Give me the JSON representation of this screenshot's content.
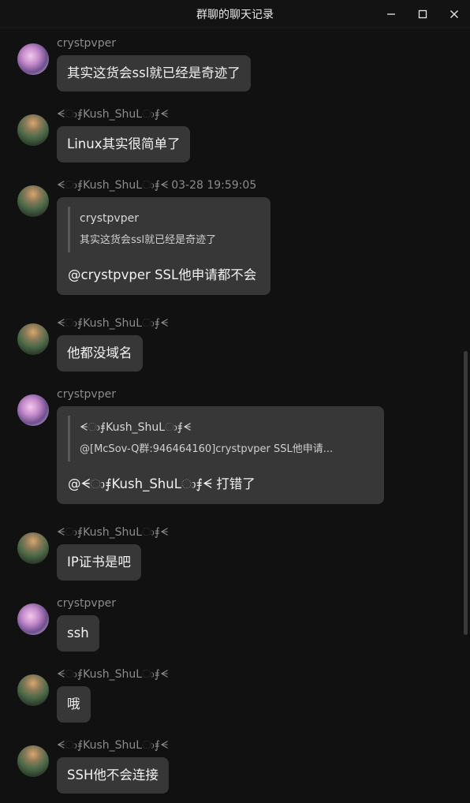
{
  "window": {
    "title": "群聊的聊天记录",
    "controls": [
      "minimize-icon",
      "maximize-icon",
      "close-icon"
    ]
  },
  "messages": [
    {
      "sender": "crystpvper",
      "avatar": "pink-anime-avatar",
      "time": "",
      "text": "其实这货会ssl就已经是奇迹了"
    },
    {
      "sender": "ᗕා⨎Kush_ShuLා⨎ᗕ",
      "avatar": "landscape-avatar",
      "time": "",
      "text": "Linux其实很简单了"
    },
    {
      "sender": "ᗕා⨎Kush_ShuLා⨎ᗕ",
      "avatar": "landscape-avatar",
      "time": "03-28 19:59:05",
      "quote": {
        "name": "crystpvper",
        "text": "其实这货会ssl就已经是奇迹了"
      },
      "text": "@crystpvper SSL他申请都不会"
    },
    {
      "sender": "ᗕා⨎Kush_ShuLා⨎ᗕ",
      "avatar": "landscape-avatar",
      "time": "",
      "text": "他都没域名"
    },
    {
      "sender": "crystpvper",
      "avatar": "pink-anime-avatar",
      "time": "",
      "quote": {
        "name": "ᗕා⨎Kush_ShuLා⨎ᗕ",
        "text": "@[McSov-Q群:946464160]crystpvper SSL他申请..."
      },
      "text": "@ᗕා⨎Kush_ShuLා⨎ᗕ 打错了"
    },
    {
      "sender": "ᗕා⨎Kush_ShuLා⨎ᗕ",
      "avatar": "landscape-avatar",
      "time": "",
      "text": "IP证书是吧"
    },
    {
      "sender": "crystpvper",
      "avatar": "pink-anime-avatar",
      "time": "",
      "text": "ssh"
    },
    {
      "sender": "ᗕා⨎Kush_ShuLා⨎ᗕ",
      "avatar": "landscape-avatar",
      "time": "",
      "text": "哦"
    },
    {
      "sender": "ᗕා⨎Kush_ShuLා⨎ᗕ",
      "avatar": "landscape-avatar",
      "time": "",
      "text": "SSH他不会连接"
    }
  ],
  "colors": {
    "background": "#111111",
    "bubble": "#373737",
    "meta": "#8c8c8c"
  }
}
